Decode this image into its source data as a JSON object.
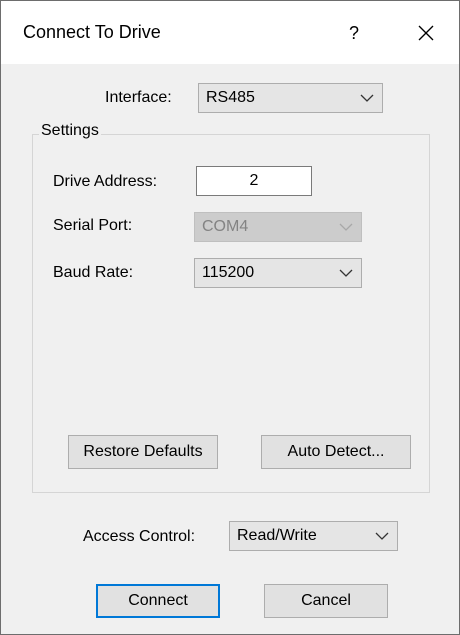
{
  "window": {
    "title": "Connect To Drive",
    "help_label": "?"
  },
  "interface": {
    "label": "Interface:",
    "value": "RS485"
  },
  "settings": {
    "group_title": "Settings",
    "drive_address": {
      "label": "Drive Address:",
      "value": "2"
    },
    "serial_port": {
      "label": "Serial Port:",
      "value": "COM4",
      "enabled": false
    },
    "baud_rate": {
      "label": "Baud Rate:",
      "value": "115200"
    },
    "restore_defaults_label": "Restore Defaults",
    "auto_detect_label": "Auto Detect..."
  },
  "access_control": {
    "label": "Access Control:",
    "value": "Read/Write"
  },
  "buttons": {
    "connect_label": "Connect",
    "cancel_label": "Cancel"
  },
  "icons": {
    "close": "close-icon",
    "dropdown": "chevron-down-icon"
  }
}
